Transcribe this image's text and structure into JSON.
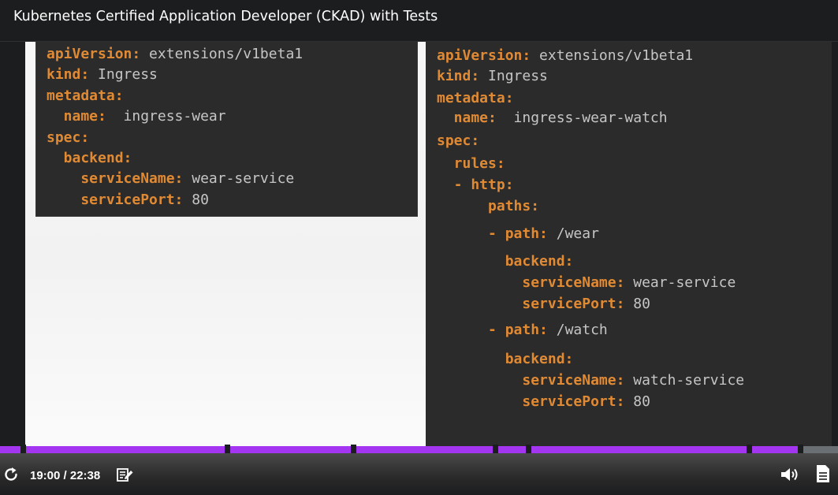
{
  "header": {
    "course_title": "Kubernetes Certified Application Developer (CKAD) with Tests"
  },
  "slide": {
    "left_code": [
      {
        "key": "apiVersion:",
        "value": " extensions/v1beta1"
      },
      {
        "key": "kind:",
        "value": " Ingress"
      },
      {
        "key": "metadata:",
        "value": ""
      },
      {
        "key": "  name:",
        "value": "  ingress-wear"
      },
      {
        "key": "spec:",
        "value": ""
      },
      {
        "key": "  backend:",
        "value": ""
      },
      {
        "key": "    serviceName:",
        "value": " wear-service"
      },
      {
        "key": "    servicePort:",
        "value": " 80"
      }
    ],
    "right_code": [
      {
        "key": "apiVersion:",
        "value": " extensions/v1beta1"
      },
      {
        "key": "kind:",
        "value": " Ingress"
      },
      {
        "key": "metadata:",
        "value": ""
      },
      {
        "key": "  name:",
        "value": "  ingress-wear-watch"
      },
      {
        "key": "spec:",
        "value": ""
      },
      {
        "key": "  rules:",
        "value": ""
      },
      {
        "key": "  - http:",
        "value": ""
      },
      {
        "key": "      paths:",
        "value": ""
      },
      {
        "key": "      - path:",
        "value": " /wear"
      },
      {
        "key": "        backend:",
        "value": ""
      },
      {
        "key": "          serviceName:",
        "value": " wear-service"
      },
      {
        "key": "          servicePort:",
        "value": " 80"
      },
      {
        "key": "      - path:",
        "value": " /watch"
      },
      {
        "key": "        backend:",
        "value": ""
      },
      {
        "key": "          serviceName:",
        "value": " watch-service"
      },
      {
        "key": "          servicePort:",
        "value": " 80"
      }
    ]
  },
  "player": {
    "time": "19:00 / 22:38",
    "progress_fraction": 0.955,
    "accent_color": "#a435f0",
    "icons": [
      "replay-icon",
      "notes-icon",
      "volume-icon",
      "transcript-icon"
    ]
  },
  "colors": {
    "code_key": "#e08a34",
    "code_value": "#c6c6c6",
    "code_background": "#2b2b2b"
  }
}
